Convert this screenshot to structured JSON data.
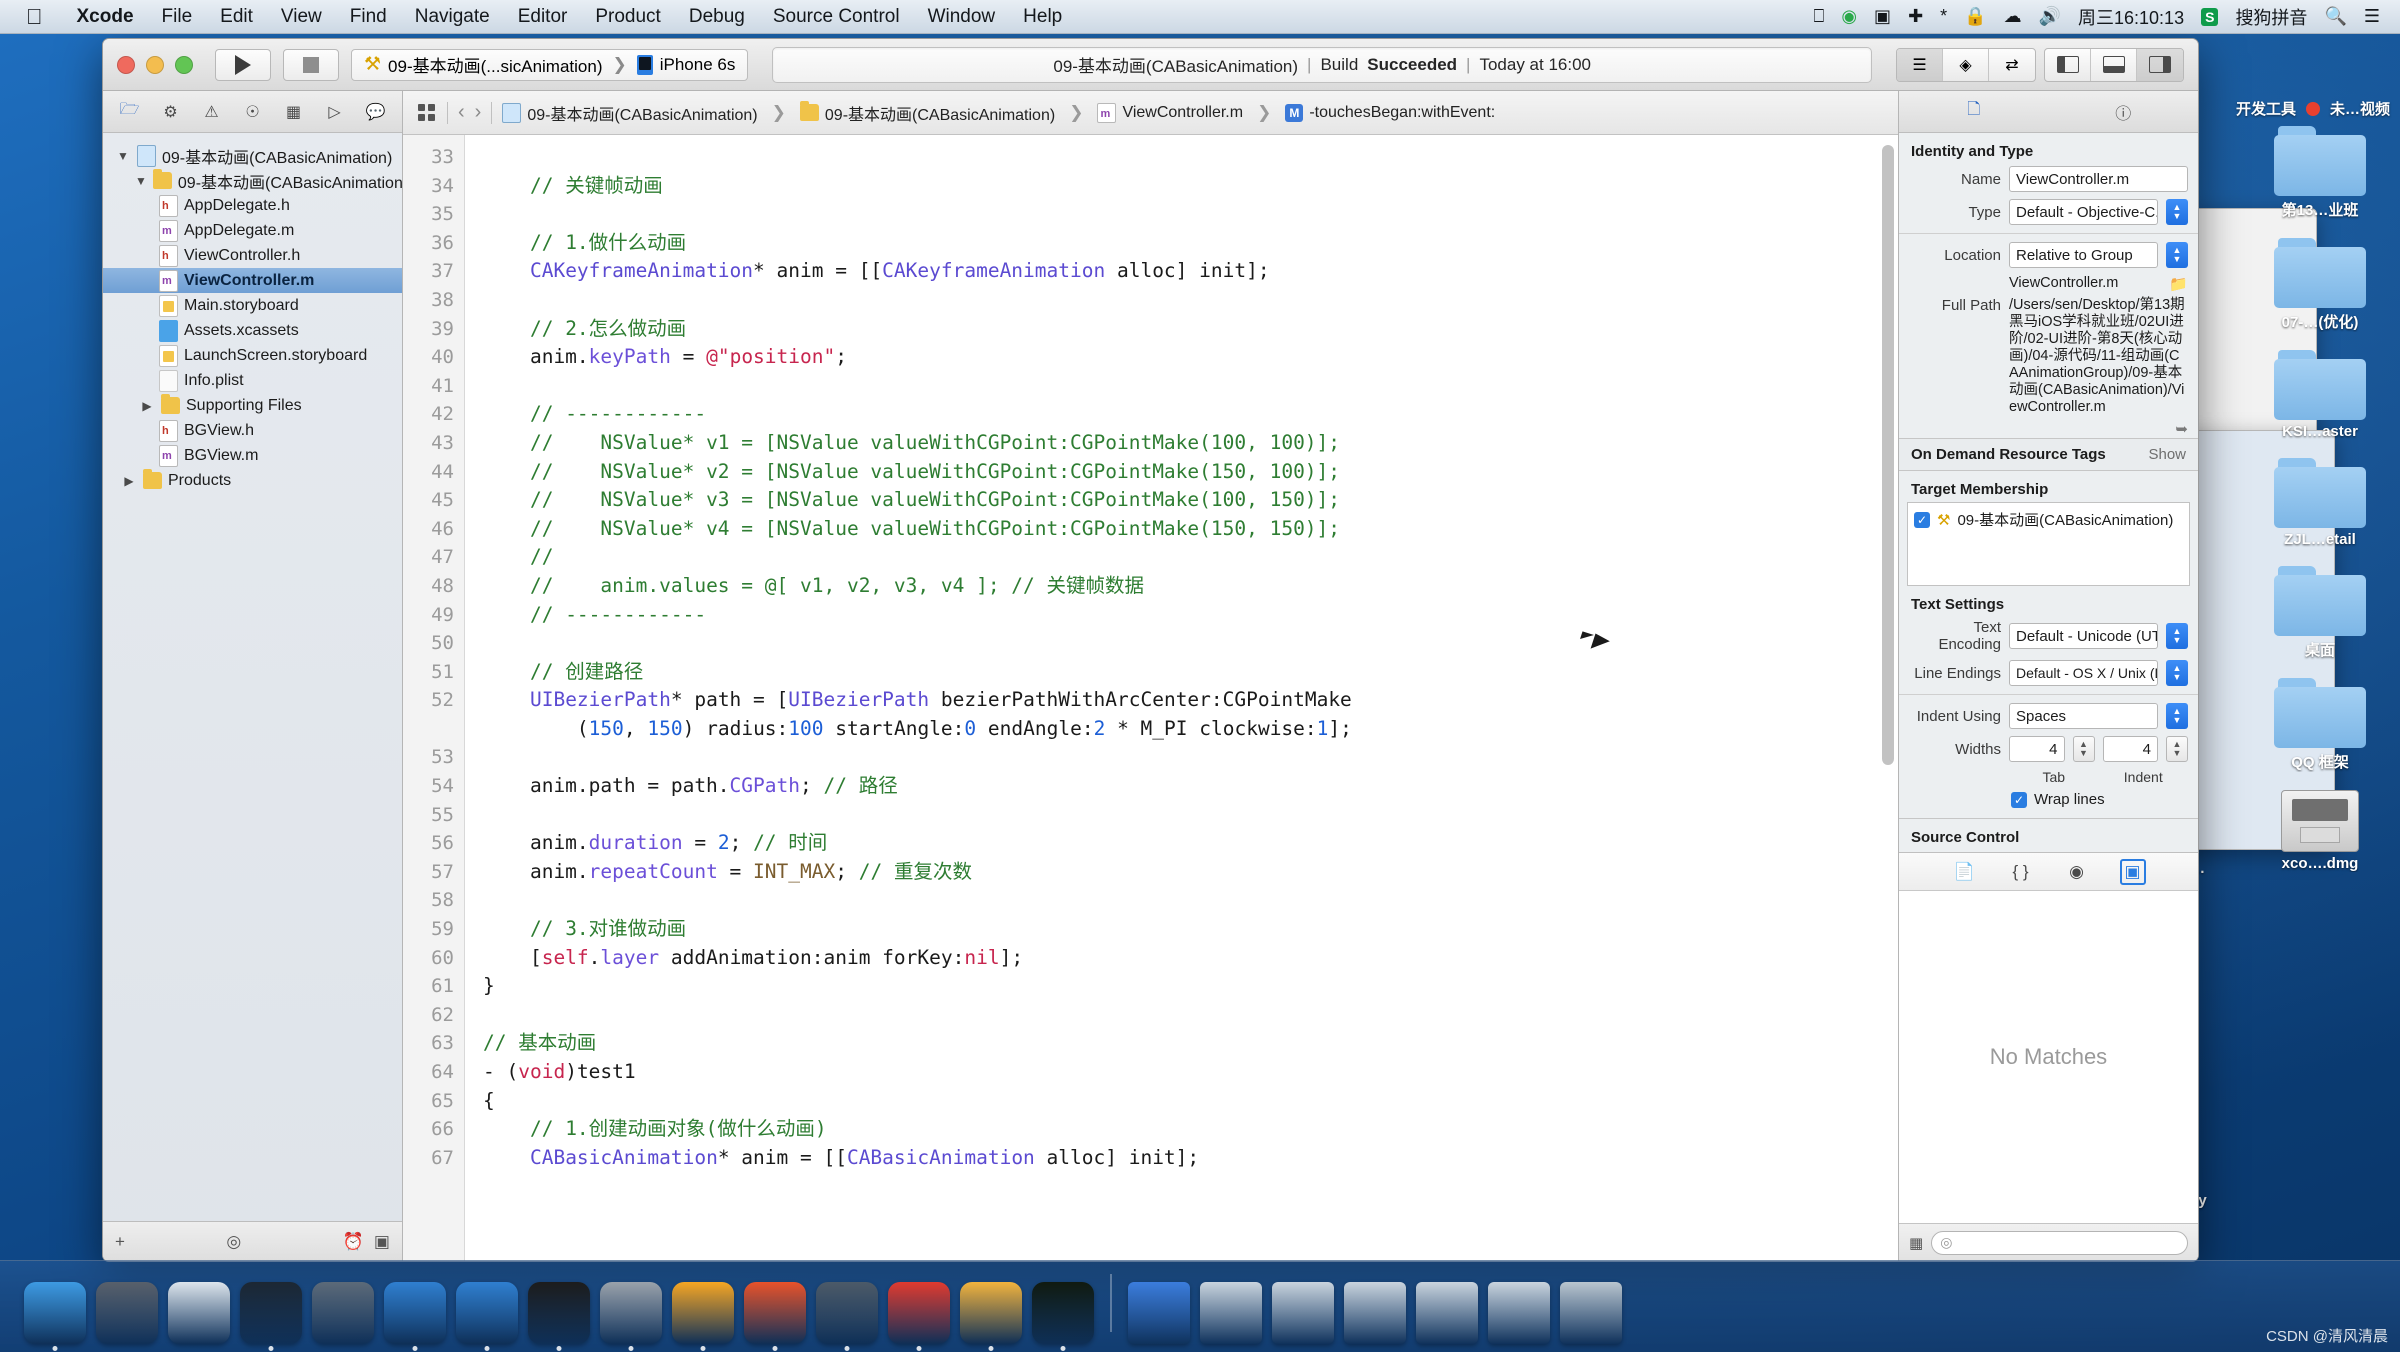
{
  "menubar": {
    "apple_icon": "apple-logo",
    "items": [
      {
        "label": "Xcode",
        "bold": true
      },
      {
        "label": "File",
        "bold": false
      },
      {
        "label": "Edit",
        "bold": false
      },
      {
        "label": "View",
        "bold": false
      },
      {
        "label": "Find",
        "bold": false
      },
      {
        "label": "Navigate",
        "bold": false
      },
      {
        "label": "Editor",
        "bold": false
      },
      {
        "label": "Product",
        "bold": false
      },
      {
        "label": "Debug",
        "bold": false
      },
      {
        "label": "Source Control",
        "bold": false
      },
      {
        "label": "Window",
        "bold": false
      },
      {
        "label": "Help",
        "bold": false
      }
    ],
    "status": {
      "clock": "周三16:10:13",
      "input_method": "搜狗拼音",
      "sogou_badge": "S",
      "icons": [
        "airplay-icon",
        "screencast-icon",
        "video-record-icon",
        "flight-mode-icon",
        "bluetooth-icon",
        "lock-icon",
        "wifi-icon",
        "volume-icon",
        "search-icon",
        "notification-center-icon"
      ]
    }
  },
  "toolbar": {
    "run_button": "run-icon",
    "stop_button": "stop-icon",
    "scheme": "09-基本动画(...sicAnimation)",
    "destination": "iPhone 6s",
    "activity": {
      "project": "09-基本动画(CABasicAnimation)",
      "sep": "|",
      "build_prefix": "Build ",
      "build_status": "Succeeded",
      "time": "Today at 16:00"
    },
    "right_icons": [
      "standard-editor-icon",
      "assistant-editor-icon",
      "version-editor-icon",
      "navigator-toggle-icon",
      "debug-area-toggle-icon",
      "inspector-toggle-icon"
    ]
  },
  "navigator": {
    "tabs": [
      "project-navigator-icon",
      "source-control-icon",
      "symbol-navigator-icon",
      "find-navigator-icon",
      "issue-navigator-icon",
      "test-navigator-icon",
      "debug-navigator-icon",
      "breakpoint-navigator-icon",
      "report-navigator-icon"
    ],
    "tree": [
      {
        "label": "09-基本动画(CABasicAnimation)",
        "indent": 0,
        "twisty": "▼",
        "icon": "project-icon",
        "selected": false
      },
      {
        "label": "09-基本动画(CABasicAnimation)",
        "indent": 1,
        "twisty": "▼",
        "icon": "folder-icon",
        "selected": false
      },
      {
        "label": "AppDelegate.h",
        "indent": 2,
        "twisty": "",
        "icon": "header-file-icon",
        "selected": false
      },
      {
        "label": "AppDelegate.m",
        "indent": 2,
        "twisty": "",
        "icon": "objc-file-icon",
        "selected": false
      },
      {
        "label": "ViewController.h",
        "indent": 2,
        "twisty": "",
        "icon": "header-file-icon",
        "selected": false
      },
      {
        "label": "ViewController.m",
        "indent": 2,
        "twisty": "",
        "icon": "objc-file-icon",
        "selected": true
      },
      {
        "label": "Main.storyboard",
        "indent": 2,
        "twisty": "",
        "icon": "storyboard-icon",
        "selected": false
      },
      {
        "label": "Assets.xcassets",
        "indent": 2,
        "twisty": "",
        "icon": "xcassets-icon",
        "selected": false
      },
      {
        "label": "LaunchScreen.storyboard",
        "indent": 2,
        "twisty": "",
        "icon": "storyboard-icon",
        "selected": false
      },
      {
        "label": "Info.plist",
        "indent": 2,
        "twisty": "",
        "icon": "plist-icon",
        "selected": false
      },
      {
        "label": "Supporting Files",
        "indent": 2,
        "twisty": "▶",
        "icon": "folder-icon",
        "selected": false
      },
      {
        "label": "BGView.h",
        "indent": 2,
        "twisty": "",
        "icon": "header-file-icon",
        "selected": false
      },
      {
        "label": "BGView.m",
        "indent": 2,
        "twisty": "",
        "icon": "objc-file-icon",
        "selected": false
      },
      {
        "label": "Products",
        "indent": 1,
        "twisty": "▶",
        "icon": "folder-icon",
        "selected": false
      }
    ],
    "footer": {
      "add_label": "+",
      "filter_icon": "filter-icon",
      "recent_icon": "recent-icon",
      "grid_icon": "grid-icon"
    }
  },
  "jumpbar": {
    "related_items_icon": "related-items-icon",
    "back": "‹",
    "forward": "›",
    "crumbs": [
      {
        "label": "09-基本动画(CABasicAnimation)",
        "icon": "project-icon"
      },
      {
        "label": "09-基本动画(CABasicAnimation)",
        "icon": "folder-icon"
      },
      {
        "label": "ViewController.m",
        "icon": "objc-file-icon"
      },
      {
        "label": "-touchesBegan:withEvent:",
        "icon": "method-icon"
      }
    ]
  },
  "code": {
    "first_line_number": 33,
    "lines": [
      {
        "n": 33,
        "tokens": []
      },
      {
        "n": 34,
        "tokens": [
          {
            "t": "    ",
            "c": ""
          },
          {
            "t": "// 关键帧动画",
            "c": "c-cmt"
          }
        ]
      },
      {
        "n": 35,
        "tokens": []
      },
      {
        "n": 36,
        "tokens": [
          {
            "t": "    ",
            "c": ""
          },
          {
            "t": "// 1.做什么动画",
            "c": "c-cmt"
          }
        ]
      },
      {
        "n": 37,
        "tokens": [
          {
            "t": "    ",
            "c": ""
          },
          {
            "t": "CAKeyframeAnimation",
            "c": "c-type"
          },
          {
            "t": "* anim = [[",
            "c": ""
          },
          {
            "t": "CAKeyframeAnimation",
            "c": "c-type"
          },
          {
            "t": " alloc] init];",
            "c": ""
          }
        ]
      },
      {
        "n": 38,
        "tokens": []
      },
      {
        "n": 39,
        "tokens": [
          {
            "t": "    ",
            "c": ""
          },
          {
            "t": "// 2.怎么做动画",
            "c": "c-cmt"
          }
        ]
      },
      {
        "n": 40,
        "tokens": [
          {
            "t": "    anim.",
            "c": ""
          },
          {
            "t": "keyPath",
            "c": "c-prop"
          },
          {
            "t": " = ",
            "c": ""
          },
          {
            "t": "@\"position\"",
            "c": "c-str"
          },
          {
            "t": ";",
            "c": ""
          }
        ]
      },
      {
        "n": 41,
        "tokens": []
      },
      {
        "n": 42,
        "tokens": [
          {
            "t": "    ",
            "c": ""
          },
          {
            "t": "// ------------",
            "c": "c-cmt"
          }
        ]
      },
      {
        "n": 43,
        "tokens": [
          {
            "t": "    ",
            "c": ""
          },
          {
            "t": "//    NSValue* v1 = [NSValue valueWithCGPoint:CGPointMake(100, 100)];",
            "c": "c-cmt"
          }
        ]
      },
      {
        "n": 44,
        "tokens": [
          {
            "t": "    ",
            "c": ""
          },
          {
            "t": "//    NSValue* v2 = [NSValue valueWithCGPoint:CGPointMake(150, 100)];",
            "c": "c-cmt"
          }
        ]
      },
      {
        "n": 45,
        "tokens": [
          {
            "t": "    ",
            "c": ""
          },
          {
            "t": "//    NSValue* v3 = [NSValue valueWithCGPoint:CGPointMake(100, 150)];",
            "c": "c-cmt"
          }
        ]
      },
      {
        "n": 46,
        "tokens": [
          {
            "t": "    ",
            "c": ""
          },
          {
            "t": "//    NSValue* v4 = [NSValue valueWithCGPoint:CGPointMake(150, 150)];",
            "c": "c-cmt"
          }
        ]
      },
      {
        "n": 47,
        "tokens": [
          {
            "t": "    ",
            "c": ""
          },
          {
            "t": "//",
            "c": "c-cmt"
          }
        ]
      },
      {
        "n": 48,
        "tokens": [
          {
            "t": "    ",
            "c": ""
          },
          {
            "t": "//    anim.values = @[ v1, v2, v3, v4 ]; // 关键帧数据",
            "c": "c-cmt"
          }
        ]
      },
      {
        "n": 49,
        "tokens": [
          {
            "t": "    ",
            "c": ""
          },
          {
            "t": "// ------------",
            "c": "c-cmt"
          }
        ]
      },
      {
        "n": 50,
        "tokens": []
      },
      {
        "n": 51,
        "tokens": [
          {
            "t": "    ",
            "c": ""
          },
          {
            "t": "// 创建路径",
            "c": "c-cmt"
          }
        ]
      },
      {
        "n": 52,
        "tokens": [
          {
            "t": "    ",
            "c": ""
          },
          {
            "t": "UIBezierPath",
            "c": "c-type"
          },
          {
            "t": "* path = [",
            "c": ""
          },
          {
            "t": "UIBezierPath",
            "c": "c-type"
          },
          {
            "t": " bezierPathWithArcCenter:CGPointMake",
            "c": ""
          }
        ]
      },
      {
        "n": "",
        "tokens": [
          {
            "t": "        (",
            "c": ""
          },
          {
            "t": "150",
            "c": "c-num"
          },
          {
            "t": ", ",
            "c": ""
          },
          {
            "t": "150",
            "c": "c-num"
          },
          {
            "t": ") radius:",
            "c": ""
          },
          {
            "t": "100",
            "c": "c-num"
          },
          {
            "t": " startAngle:",
            "c": ""
          },
          {
            "t": "0",
            "c": "c-num"
          },
          {
            "t": " endAngle:",
            "c": ""
          },
          {
            "t": "2",
            "c": "c-num"
          },
          {
            "t": " * M_PI clockwise:",
            "c": ""
          },
          {
            "t": "1",
            "c": "c-num"
          },
          {
            "t": "];",
            "c": ""
          }
        ]
      },
      {
        "n": 53,
        "tokens": []
      },
      {
        "n": 54,
        "tokens": [
          {
            "t": "    anim.path = path.",
            "c": ""
          },
          {
            "t": "CGPath",
            "c": "c-prop"
          },
          {
            "t": "; ",
            "c": ""
          },
          {
            "t": "// 路径",
            "c": "c-cmt"
          }
        ]
      },
      {
        "n": 55,
        "tokens": []
      },
      {
        "n": 56,
        "tokens": [
          {
            "t": "    anim.",
            "c": ""
          },
          {
            "t": "duration",
            "c": "c-prop"
          },
          {
            "t": " = ",
            "c": ""
          },
          {
            "t": "2",
            "c": "c-num"
          },
          {
            "t": "; ",
            "c": ""
          },
          {
            "t": "// 时间",
            "c": "c-cmt"
          }
        ]
      },
      {
        "n": 57,
        "tokens": [
          {
            "t": "    anim.",
            "c": ""
          },
          {
            "t": "repeatCount",
            "c": "c-prop"
          },
          {
            "t": " = ",
            "c": ""
          },
          {
            "t": "INT_MAX",
            "c": "c-macro"
          },
          {
            "t": "; ",
            "c": ""
          },
          {
            "t": "// 重复次数",
            "c": "c-cmt"
          }
        ]
      },
      {
        "n": 58,
        "tokens": []
      },
      {
        "n": 59,
        "tokens": [
          {
            "t": "    ",
            "c": ""
          },
          {
            "t": "// 3.对谁做动画",
            "c": "c-cmt"
          }
        ]
      },
      {
        "n": 60,
        "tokens": [
          {
            "t": "    [",
            "c": ""
          },
          {
            "t": "self",
            "c": "c-self"
          },
          {
            "t": ".",
            "c": ""
          },
          {
            "t": "layer",
            "c": "c-prop"
          },
          {
            "t": " addAnimation:anim forKey:",
            "c": ""
          },
          {
            "t": "nil",
            "c": "c-self"
          },
          {
            "t": "];",
            "c": ""
          }
        ]
      },
      {
        "n": 61,
        "tokens": [
          {
            "t": "}",
            "c": ""
          }
        ]
      },
      {
        "n": 62,
        "tokens": []
      },
      {
        "n": 63,
        "tokens": [
          {
            "t": "// 基本动画",
            "c": "c-cmt"
          }
        ]
      },
      {
        "n": 64,
        "tokens": [
          {
            "t": "- (",
            "c": ""
          },
          {
            "t": "void",
            "c": "c-self"
          },
          {
            "t": ")test1",
            "c": ""
          }
        ]
      },
      {
        "n": 65,
        "tokens": [
          {
            "t": "{",
            "c": ""
          }
        ]
      },
      {
        "n": 66,
        "tokens": [
          {
            "t": "    ",
            "c": ""
          },
          {
            "t": "// 1.创建动画对象(做什么动画)",
            "c": "c-cmt"
          }
        ]
      },
      {
        "n": 67,
        "tokens": [
          {
            "t": "    ",
            "c": ""
          },
          {
            "t": "CABasicAnimation",
            "c": "c-type"
          },
          {
            "t": "* anim = [[",
            "c": ""
          },
          {
            "t": "CABasicAnimation",
            "c": "c-type"
          },
          {
            "t": " alloc] init];",
            "c": ""
          }
        ]
      }
    ]
  },
  "inspector": {
    "tabs": [
      "file-inspector-icon",
      "quick-help-icon",
      "identity-inspector-icon",
      "attributes-inspector-icon",
      "size-inspector-icon",
      "connections-inspector-icon"
    ],
    "identity_and_type": {
      "header": "Identity and Type",
      "name_label": "Name",
      "name_value": "ViewController.m",
      "type_label": "Type",
      "type_value": "Default - Objective-C...",
      "location_label": "Location",
      "location_value": "Relative to Group",
      "location_file": "ViewController.m",
      "full_path_label": "Full Path",
      "full_path_value": "/Users/sen/Desktop/第13期黑马iOS学科就业班/02UI进阶/02-UI进阶-第8天(核心动画)/04-源代码/11-组动画(CAAnimationGroup)/09-基本动画(CABasicAnimation)/ViewController.m"
    },
    "on_demand": {
      "header": "On Demand Resource Tags",
      "show": "Show"
    },
    "target_membership": {
      "header": "Target Membership",
      "items": [
        {
          "label": "09-基本动画(CABasicAnimation)",
          "checked": true
        }
      ]
    },
    "text_settings": {
      "header": "Text Settings",
      "encoding_label": "Text Encoding",
      "encoding_value": "Default - Unicode (UT...",
      "line_endings_label": "Line Endings",
      "line_endings_value": "Default - OS X / Unix (LF)",
      "indent_label": "Indent Using",
      "indent_value": "Spaces",
      "widths_label": "Widths",
      "tab_width": "4",
      "indent_width": "4",
      "tab_sub": "Tab",
      "indent_sub": "Indent",
      "wrap_label": "Wrap lines",
      "wrap_checked": true
    },
    "source_control": {
      "header": "Source Control"
    }
  },
  "library": {
    "tabs": [
      "file-template-library-icon",
      "code-snippet-library-icon",
      "object-library-icon",
      "media-library-icon"
    ],
    "active_tab_index": 3,
    "empty_message": "No Matches",
    "footer": {
      "grid_icon": "grid-icon",
      "search_placeholder": ""
    }
  },
  "desktop": {
    "top_labels": [
      "开发工具",
      "未…视频"
    ],
    "icons": [
      {
        "label": "第13…业班",
        "type": "folder"
      },
      {
        "label": "07-…(优化)",
        "type": "folder"
      },
      {
        "label": "KSI…aster",
        "type": "folder"
      },
      {
        "label": "ZJL…etail",
        "type": "folder"
      },
      {
        "label": "桌面",
        "type": "folder"
      },
      {
        "label": "QQ 框架",
        "type": "folder"
      },
      {
        "label": "xco….dmg",
        "type": "dmg"
      }
    ],
    "partial_labels": [
      "n)…",
      "opy"
    ]
  },
  "dock": {
    "items": [
      {
        "name": "finder",
        "color": "#3d9ae2",
        "running": true
      },
      {
        "name": "launchpad",
        "color": "#58606b",
        "running": false
      },
      {
        "name": "safari",
        "color": "#dde5ec",
        "running": false
      },
      {
        "name": "itunes",
        "color": "#1c2733",
        "running": true
      },
      {
        "name": "imovie",
        "color": "#5c6a79",
        "running": false
      },
      {
        "name": "xcode-beta",
        "color": "#2f7fd0",
        "running": true
      },
      {
        "name": "xcode",
        "color": "#2f7fd0",
        "running": true
      },
      {
        "name": "terminal",
        "color": "#1c1c1c",
        "running": true
      },
      {
        "name": "system-preferences",
        "color": "#9aa2ab",
        "running": true
      },
      {
        "name": "sketch",
        "color": "#f6a623",
        "running": true
      },
      {
        "name": "paw",
        "color": "#e8522a",
        "running": true
      },
      {
        "name": "quicktime",
        "color": "#4c5a68",
        "running": true
      },
      {
        "name": "sogou-input",
        "color": "#e03a2f",
        "running": true
      },
      {
        "name": "notes",
        "color": "#f2b33d",
        "running": true
      },
      {
        "name": "iterm",
        "color": "#101a10",
        "running": true
      }
    ],
    "minimized": [
      {
        "name": "chrome-window",
        "color": "#3b7ddd"
      },
      {
        "name": "xcode-window-1",
        "color": "#c9d4de"
      },
      {
        "name": "xcode-window-2",
        "color": "#c9d4de"
      },
      {
        "name": "xcode-window-3",
        "color": "#c9d4de"
      },
      {
        "name": "xcode-window-4",
        "color": "#c9d4de"
      },
      {
        "name": "xcode-window-5",
        "color": "#c9d4de"
      },
      {
        "name": "trash",
        "color": "#b9c5cf"
      }
    ]
  },
  "watermark": "CSDN @清风清晨"
}
